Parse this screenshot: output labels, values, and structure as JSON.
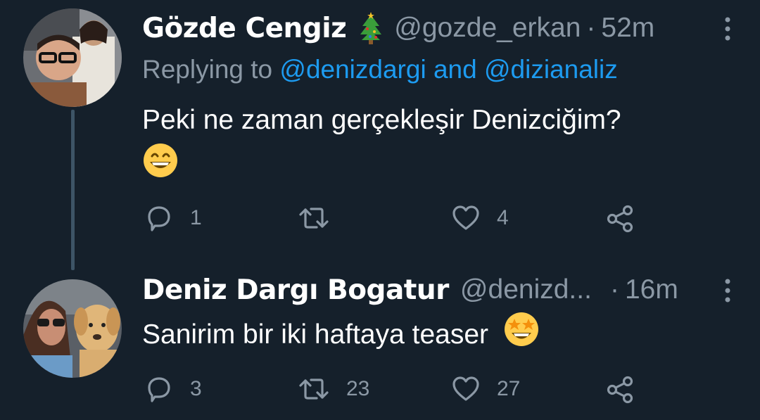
{
  "tweets": [
    {
      "display_name": "Gözde Cengiz",
      "name_icon": "christmas-tree-icon",
      "handle": "@gozde_erkan",
      "separator": "·",
      "time": "52m",
      "replying_prefix": "Replying to",
      "reply_mentions": [
        "@denizdargi",
        "@dizianaliz"
      ],
      "reply_joiner": "and",
      "text": "Peki ne zaman gerçekleşir Denizciğim?",
      "emoji": "grinning-face-icon",
      "replies": "1",
      "retweets": "",
      "likes": "4"
    },
    {
      "display_name": "Deniz Dargı Bogatur",
      "handle": "@denizd...",
      "separator": "·",
      "time": "16m",
      "text": "Sanirim bir iki haftaya teaser",
      "emoji": "star-struck-icon",
      "replies": "3",
      "retweets": "23",
      "likes": "27"
    }
  ],
  "colors": {
    "background": "#15202b",
    "secondary_text": "#8b98a5",
    "link": "#1d9bf0",
    "thread_line": "#3d5466"
  }
}
